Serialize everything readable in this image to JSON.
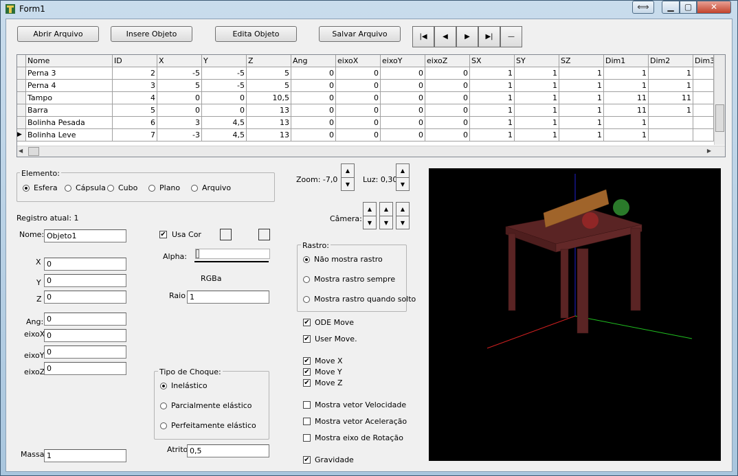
{
  "window": {
    "title": "Form1",
    "restore_glyph": "⟺",
    "min_glyph": "▁",
    "max_glyph": "▢",
    "close_glyph": "✕"
  },
  "toolbar": {
    "open_file": "Abrir Arquivo",
    "insert_object": "Insere Objeto",
    "edit_object": "Edita Objeto",
    "save_file": "Salvar Arquivo",
    "nav": {
      "first": "|◀",
      "prev": "◀",
      "next": "▶",
      "last": "▶|",
      "delete": "—"
    }
  },
  "grid": {
    "columns": [
      "Nome",
      "ID",
      "X",
      "Y",
      "Z",
      "Ang",
      "eixoX",
      "eixoY",
      "eixoZ",
      "SX",
      "SY",
      "SZ",
      "Dim1",
      "Dim2",
      "Dim3"
    ],
    "rows": [
      [
        "Perna 3",
        "2",
        "-5",
        "-5",
        "5",
        "0",
        "0",
        "0",
        "0",
        "1",
        "1",
        "1",
        "1",
        "1",
        ""
      ],
      [
        "Perna 4",
        "3",
        "5",
        "-5",
        "5",
        "0",
        "0",
        "0",
        "0",
        "1",
        "1",
        "1",
        "1",
        "1",
        ""
      ],
      [
        "Tampo",
        "4",
        "0",
        "0",
        "10,5",
        "0",
        "0",
        "0",
        "0",
        "1",
        "1",
        "1",
        "11",
        "11",
        ""
      ],
      [
        "Barra",
        "5",
        "0",
        "0",
        "13",
        "0",
        "0",
        "0",
        "0",
        "1",
        "1",
        "1",
        "11",
        "1",
        ""
      ],
      [
        "Bolinha Pesada",
        "6",
        "3",
        "4,5",
        "13",
        "0",
        "0",
        "0",
        "0",
        "1",
        "1",
        "1",
        "1",
        "",
        ""
      ],
      [
        "Bolinha Leve",
        "7",
        "-3",
        "4,5",
        "13",
        "0",
        "0",
        "0",
        "0",
        "1",
        "1",
        "1",
        "1",
        "",
        ""
      ]
    ],
    "current_row": 5
  },
  "elemento": {
    "label": "Elemento:",
    "options": [
      "Esfera",
      "Cápsula",
      "Cubo",
      "Plano",
      "Arquivo"
    ],
    "selected": 0
  },
  "registro": {
    "label": "Registro atual: 1"
  },
  "fields": {
    "nome_label": "Nome:",
    "nome_value": "Objeto1",
    "x_label": "X",
    "x_value": "0",
    "y_label": "Y",
    "y_value": "0",
    "z_label": "Z",
    "z_value": "0",
    "ang_label": "Ang:",
    "ang_value": "0",
    "eixox_label": "eixoX",
    "eixox_value": "0",
    "eixoy_label": "eixoY",
    "eixoy_value": "0",
    "eixoz_label": "eixoZ",
    "eixoz_value": "0",
    "massa_label": "Massa",
    "massa_value": "1"
  },
  "color": {
    "usa_cor_label": "Usa Cor",
    "usa_cor_checked": true,
    "alpha_label": "Alpha:",
    "rgba_label": "RGBa",
    "raio_label": "Raio",
    "raio_value": "1"
  },
  "choque": {
    "label": "Tipo de Choque:",
    "options": [
      "Inelástico",
      "Parcialmente elástico",
      "Perfeitamente elástico"
    ],
    "selected": 0,
    "atrito_label": "Atrito",
    "atrito_value": "0,5"
  },
  "view": {
    "zoom_label": "Zoom: -7,0",
    "luz_label": "Luz: 0,30",
    "camera_label": "Câmera:"
  },
  "rastro": {
    "label": "Rastro:",
    "options": [
      "Não mostra rastro",
      "Mostra rastro sempre",
      "Mostra rastro quando solto"
    ],
    "selected": 0
  },
  "checks": [
    {
      "label": "ODE Move",
      "checked": true
    },
    {
      "label": "User Move.",
      "checked": true
    },
    {
      "label": "Move X",
      "checked": true
    },
    {
      "label": "Move Y",
      "checked": true
    },
    {
      "label": "Move Z",
      "checked": true
    },
    {
      "label": "Mostra vetor Velocidade",
      "checked": false
    },
    {
      "label": "Mostra vetor Aceleração",
      "checked": false
    },
    {
      "label": "Mostra eixo de Rotação",
      "checked": false
    },
    {
      "label": "Gravidade",
      "checked": true
    }
  ],
  "colors": {
    "table": "#5a2424",
    "bar": "#a0642a",
    "red_ball": "#b42828",
    "green_ball": "#2a7a2a"
  }
}
